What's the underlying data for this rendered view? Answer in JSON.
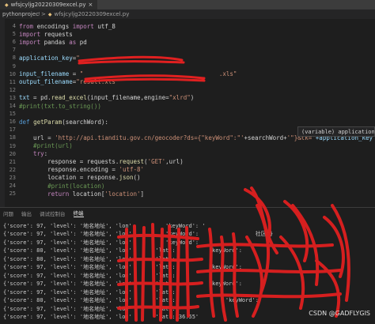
{
  "titlebar": {
    "tab_label": "wfsjcyljg20220309excel.py",
    "close": "×"
  },
  "breadcrumb": {
    "project": "pythonproject",
    "separator": ">",
    "file": "wfsjcyljg20220309excel.py"
  },
  "editor": {
    "lines": [
      {
        "n": "4",
        "tokens": [
          {
            "t": "from",
            "c": "kw"
          },
          {
            "t": " encodings ",
            "c": "plain"
          },
          {
            "t": "import",
            "c": "kw"
          },
          {
            "t": " utf_8",
            "c": "plain"
          }
        ]
      },
      {
        "n": "5",
        "tokens": [
          {
            "t": "import",
            "c": "kw"
          },
          {
            "t": " requests",
            "c": "plain"
          }
        ]
      },
      {
        "n": "6",
        "tokens": [
          {
            "t": "import",
            "c": "kw"
          },
          {
            "t": " pandas ",
            "c": "plain"
          },
          {
            "t": "as",
            "c": "kw"
          },
          {
            "t": " pd",
            "c": "plain"
          }
        ]
      },
      {
        "n": "7",
        "tokens": []
      },
      {
        "n": "8",
        "tokens": [
          {
            "t": "application_key",
            "c": "var"
          },
          {
            "t": "=",
            "c": "plain"
          },
          {
            "t": "\"",
            "c": "str"
          }
        ]
      },
      {
        "n": "9",
        "tokens": []
      },
      {
        "n": "10",
        "tokens": [
          {
            "t": "input_filename",
            "c": "var"
          },
          {
            "t": " = ",
            "c": "plain"
          },
          {
            "t": "\"",
            "c": "str"
          },
          {
            "t": "                                      ",
            "c": "plain"
          },
          {
            "t": ".xls\"",
            "c": "str"
          }
        ]
      },
      {
        "n": "11",
        "tokens": [
          {
            "t": "output_filename",
            "c": "var"
          },
          {
            "t": "=",
            "c": "plain"
          },
          {
            "t": "\"result.xls\"",
            "c": "str"
          }
        ]
      },
      {
        "n": "12",
        "tokens": []
      },
      {
        "n": "13",
        "tokens": [
          {
            "t": "txt",
            "c": "var"
          },
          {
            "t": " = pd.",
            "c": "plain"
          },
          {
            "t": "read_excel",
            "c": "fn"
          },
          {
            "t": "(input_filename,engine=",
            "c": "plain"
          },
          {
            "t": "\"xlrd\"",
            "c": "str"
          },
          {
            "t": ")",
            "c": "plain"
          }
        ]
      },
      {
        "n": "14",
        "tokens": [
          {
            "t": "#print(txt.to_string())",
            "c": "cm"
          }
        ]
      },
      {
        "n": "15",
        "tokens": []
      },
      {
        "n": "16",
        "tokens": [
          {
            "t": "def",
            "c": "kw2"
          },
          {
            "t": " ",
            "c": "plain"
          },
          {
            "t": "getParam",
            "c": "fn"
          },
          {
            "t": "(searchWord):",
            "c": "plain"
          }
        ]
      },
      {
        "n": "17",
        "tokens": []
      },
      {
        "n": "18",
        "tokens": [
          {
            "t": "    url = ",
            "c": "plain"
          },
          {
            "t": "'http://api.tianditu.gov.cn/geocoder?ds={\"keyWord\":\"'",
            "c": "str"
          },
          {
            "t": "+searchWord+",
            "c": "plain"
          },
          {
            "t": "'\"}&tk='",
            "c": "str"
          },
          {
            "t": "+application_key",
            "c": "var"
          }
        ]
      },
      {
        "n": "19",
        "tokens": [
          {
            "t": "    #print(url)",
            "c": "cm"
          }
        ]
      },
      {
        "n": "20",
        "tokens": [
          {
            "t": "    try",
            "c": "kw"
          },
          {
            "t": ":",
            "c": "plain"
          }
        ]
      },
      {
        "n": "21",
        "tokens": [
          {
            "t": "        response = requests.",
            "c": "plain"
          },
          {
            "t": "request",
            "c": "fn"
          },
          {
            "t": "(",
            "c": "plain"
          },
          {
            "t": "'GET'",
            "c": "str"
          },
          {
            "t": ",url)",
            "c": "plain"
          }
        ]
      },
      {
        "n": "22",
        "tokens": [
          {
            "t": "        response.encoding = ",
            "c": "plain"
          },
          {
            "t": "'utf-8'",
            "c": "str"
          }
        ]
      },
      {
        "n": "23",
        "tokens": [
          {
            "t": "        location = response.",
            "c": "plain"
          },
          {
            "t": "json",
            "c": "fn"
          },
          {
            "t": "()",
            "c": "plain"
          }
        ]
      },
      {
        "n": "24",
        "tokens": [
          {
            "t": "        #print(location)",
            "c": "cm"
          }
        ]
      },
      {
        "n": "25",
        "tokens": [
          {
            "t": "        ",
            "c": "plain"
          },
          {
            "t": "return",
            "c": "kw"
          },
          {
            "t": " location[",
            "c": "plain"
          },
          {
            "t": "'location'",
            "c": "str"
          },
          {
            "t": "]",
            "c": "plain"
          }
        ]
      }
    ]
  },
  "tooltip": {
    "text": "(variable) application_"
  },
  "panel": {
    "tabs": [
      {
        "label": "问题",
        "active": false
      },
      {
        "label": "输出",
        "active": false
      },
      {
        "label": "调试控制台",
        "active": false
      },
      {
        "label": "终端",
        "active": true
      }
    ]
  },
  "terminal": {
    "lines": [
      "{'score': 97, 'level': '地名地址', 'lon'          'keyWord': '",
      "{'score': 97, 'level': '地名地址', 'lon'          'keyWord':                 社区'}",
      "{'score': 97, 'level': '地名地址', 'lon'          'keyWord':",
      "{'score': 80, 'level': '地名地址', 'lon'       'lat':          'keyWord':",
      "{'score': 80, 'level': '地名地址', 'lon'       'lat':",
      "{'score': 97, 'level': '地名地址', 'lon'       'lat':          'keyWord':",
      "{'score': 97, 'level': '地名地址', 'lon'       'lat':",
      "{'score': 97, 'level': '地名地址', 'lon'       'lat':          'keyWord':",
      "{'score': 97, 'level': '地名地址', 'lon'       'lat':",
      "{'score': 80, 'level': '地名地址', 'lon'       'lat':               'keyWord':",
      "{'score': 97, 'level': '地名地址', 'lon'       'lat':",
      "{'score': 97, 'level': '地名地址', 'lon'       'lat': 36.55'"
    ]
  },
  "watermark": "CSDN @GADFLYGIS",
  "colors": {
    "redaction": "#e02020",
    "editor_bg": "#1e1e1e"
  }
}
